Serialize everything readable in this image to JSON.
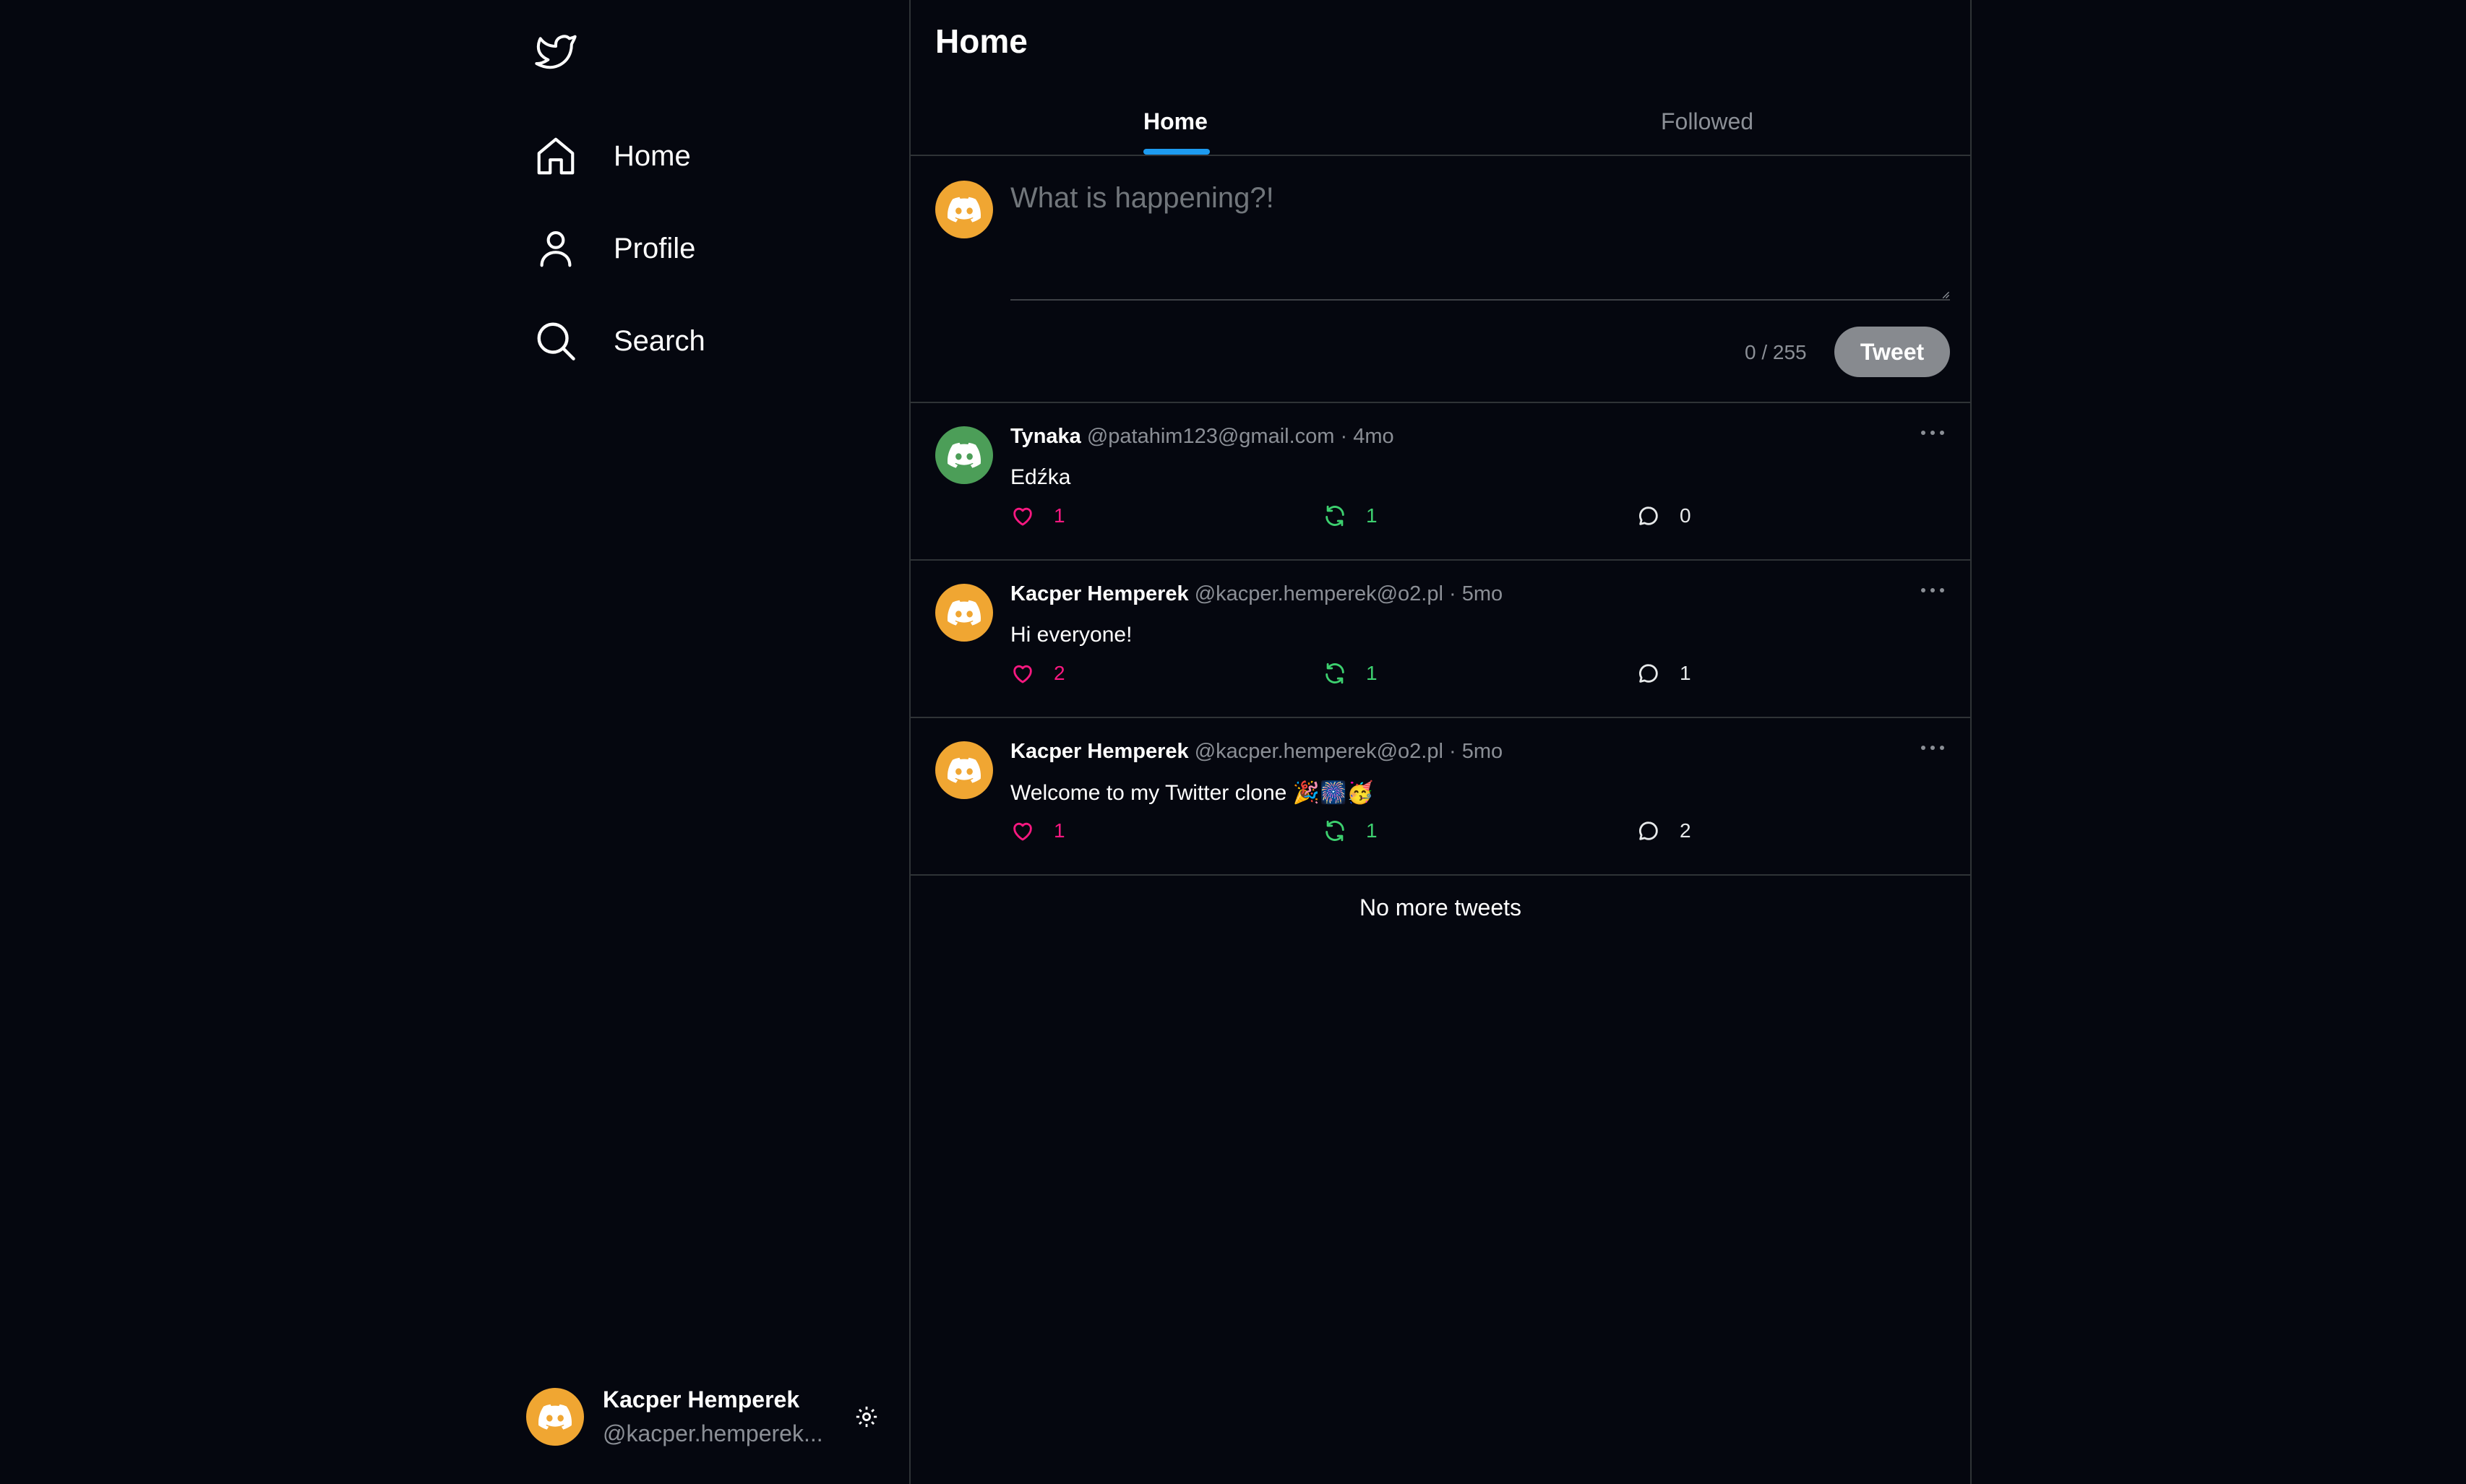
{
  "sidebar": {
    "logo": "bird-icon",
    "items": [
      {
        "label": "Home",
        "icon": "home-icon"
      },
      {
        "label": "Profile",
        "icon": "user-icon"
      },
      {
        "label": "Search",
        "icon": "search-icon"
      }
    ],
    "account": {
      "name": "Kacper Hemperek",
      "handle": "@kacper.hemperek..."
    }
  },
  "header": {
    "title": "Home"
  },
  "tabs": [
    {
      "label": "Home",
      "active": true
    },
    {
      "label": "Followed",
      "active": false
    }
  ],
  "composer": {
    "placeholder": "What is happening?!",
    "char_count": "0 / 255",
    "submit_label": "Tweet"
  },
  "tweets": [
    {
      "name": "Tynaka",
      "handle": "@patahim123@gmail.com",
      "time": "· 4mo",
      "text": "Edźka",
      "likes": "1",
      "retweets": "1",
      "replies": "0",
      "avatar_color": "#4c9e58"
    },
    {
      "name": "Kacper Hemperek",
      "handle": "@kacper.hemperek@o2.pl",
      "time": "· 5mo",
      "text": "Hi everyone!",
      "likes": "2",
      "retweets": "1",
      "replies": "1",
      "avatar_color": "#f0a632"
    },
    {
      "name": "Kacper Hemperek",
      "handle": "@kacper.hemperek@o2.pl",
      "time": "· 5mo",
      "text": "Welcome to my Twitter clone 🎉🎆🥳",
      "likes": "1",
      "retweets": "1",
      "replies": "2",
      "avatar_color": "#f0a632"
    }
  ],
  "footer": {
    "end_message": "No more tweets"
  },
  "colors": {
    "background": "#05070f",
    "accent": "#1d9bf0",
    "like": "#f91880",
    "retweet": "#3dd06f",
    "avatar_orange": "#f0a632",
    "avatar_green": "#4c9e58"
  }
}
